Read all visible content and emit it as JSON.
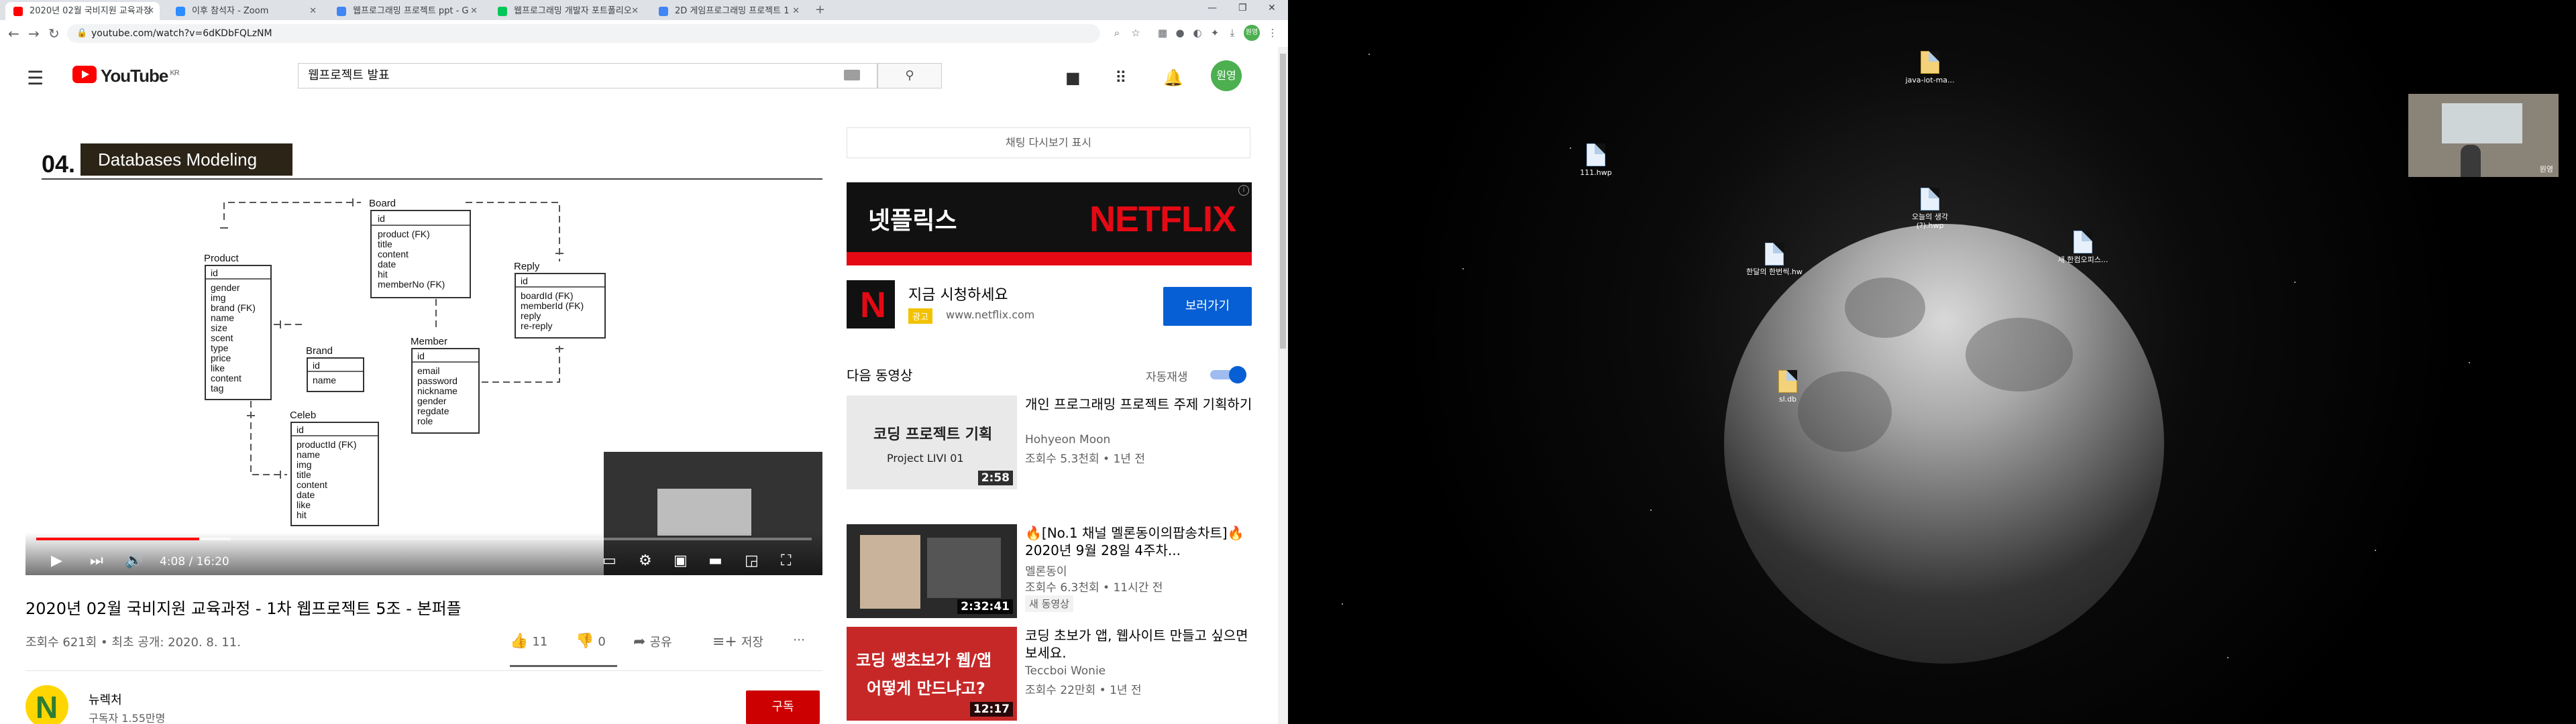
{
  "browser": {
    "tabs": [
      {
        "label": "2020년 02월 국비지원 교육과정",
        "active": true,
        "favicon_color": "#ff0000"
      },
      {
        "label": "이후 참석자 - Zoom",
        "active": false,
        "favicon_color": "#2d8cff"
      },
      {
        "label": "웹프로그래밍 프로젝트 ppt - G",
        "active": false,
        "favicon_color": "#4285f4"
      },
      {
        "label": "웹프로그래밍 개발자 포트폴리오",
        "active": false,
        "favicon_color": "#03c75a"
      },
      {
        "label": "2D 게임프로그래밍 프로젝트 1",
        "active": false,
        "favicon_color": "#4285f4"
      }
    ],
    "url": "youtube.com/watch?v=6dKDbFQLzNM",
    "profile_initials": "원영"
  },
  "youtube": {
    "logo_text": "YouTube",
    "logo_region": "KR",
    "search_query": "웹프로젝트 발표",
    "avatar_initials": "원영",
    "video": {
      "slide_number": "04.",
      "slide_title": "Databases Modeling",
      "time_current": "4:08",
      "time_total": "16:20",
      "time_sep": " / ",
      "progress": 0.21
    },
    "title": "2020년 02월 국비지원 교육과정 - 1차 웹프로젝트 5조 - 본퍼플",
    "views": "조회수 621회",
    "published": "최초 공개: 2020. 8. 11.",
    "meta_sep": " • ",
    "likes": "11",
    "dislikes": "0",
    "share_label": "공유",
    "save_label": "저장",
    "like_ratio": 1.0,
    "channel": {
      "name": "뉴렉처",
      "subscribers": "구독자 1.55만명"
    },
    "subscribe_label": "구독"
  },
  "sidebar": {
    "chat_replay": "채팅 다시보기 표시",
    "ad": {
      "banner_korean": "넷플릭스",
      "banner_brand": "NETFLIX",
      "title": "지금 시청하세요",
      "badge": "광고",
      "url": "www.netflix.com",
      "button": "보러가기"
    },
    "up_next": "다음 동영상",
    "autoplay_label": "자동재생",
    "autoplay_on": true,
    "recommendations": [
      {
        "title": "개인 프로그래밍 프로젝트 주제 기획하기",
        "channel": "Hohyeon Moon",
        "stats": "조회수 5.3천회 • 1년 전",
        "duration": "2:58",
        "thumb_text": "코딩 프로젝트 기획",
        "thumb_sub": "Project LIVI 01"
      },
      {
        "title": "🔥[No.1 채널 멜론동이의팝송차트]🔥 2020년 9월 28일 4주차...",
        "channel": "멜론동이",
        "stats": "조회수 6.3천회 • 11시간 전",
        "duration": "2:32:41",
        "badge": "새 동영상"
      },
      {
        "title": "코딩 초보가 앱, 웹사이트 만들고 싶으면 보세요.",
        "channel": "Teccboi Wonie",
        "stats": "조회수 22만회 • 1년 전",
        "duration": "12:17",
        "thumb_text": "코딩 쌩초보가 웹/앱",
        "thumb_sub": "어떻게 만드냐고?"
      }
    ]
  },
  "erd": {
    "tables": [
      {
        "name": "Board",
        "fields": [
          "id",
          "product (FK)",
          "title",
          "content",
          "date",
          "hit",
          "memberNo (FK)"
        ]
      },
      {
        "name": "Product",
        "fields": [
          "id",
          "gender",
          "img",
          "brand (FK)",
          "name",
          "size",
          "scent",
          "type",
          "price",
          "like",
          "content",
          "tag"
        ]
      },
      {
        "name": "Reply",
        "fields": [
          "id",
          "boardId (FK)",
          "memberId (FK)",
          "reply",
          "re-reply"
        ]
      },
      {
        "name": "Brand",
        "fields": [
          "id",
          "name"
        ]
      },
      {
        "name": "Member",
        "fields": [
          "id",
          "email",
          "password",
          "nickname",
          "gender",
          "regdate",
          "role"
        ]
      },
      {
        "name": "Celeb",
        "fields": [
          "id",
          "productId (FK)",
          "name",
          "img",
          "title",
          "content",
          "date",
          "like",
          "hit"
        ]
      }
    ]
  },
  "desktop": {
    "icons": [
      {
        "label": "java-iot-ma..."
      },
      {
        "label": "111.hwp"
      },
      {
        "label": "오늘의 생각(?).hwp"
      },
      {
        "label": "한달의 한번씩.hw"
      },
      {
        "label": "새 한컴오피스..."
      },
      {
        "label": "sl.db"
      }
    ],
    "webcam_label": "원영"
  }
}
